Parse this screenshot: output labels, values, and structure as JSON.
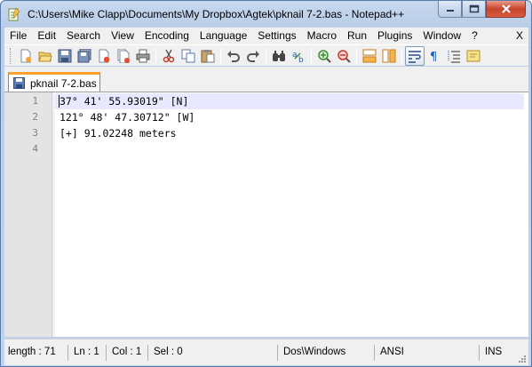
{
  "window": {
    "title": "C:\\Users\\Mike Clapp\\Documents\\My Dropbox\\Agtek\\pknail 7-2.bas - Notepad++"
  },
  "menu": [
    {
      "label": "File",
      "name": "menu-file"
    },
    {
      "label": "Edit",
      "name": "menu-edit"
    },
    {
      "label": "Search",
      "name": "menu-search"
    },
    {
      "label": "View",
      "name": "menu-view"
    },
    {
      "label": "Encoding",
      "name": "menu-encoding"
    },
    {
      "label": "Language",
      "name": "menu-language"
    },
    {
      "label": "Settings",
      "name": "menu-settings"
    },
    {
      "label": "Macro",
      "name": "menu-macro"
    },
    {
      "label": "Run",
      "name": "menu-run"
    },
    {
      "label": "Plugins",
      "name": "menu-plugins"
    },
    {
      "label": "Window",
      "name": "menu-window"
    },
    {
      "label": "?",
      "name": "menu-help"
    }
  ],
  "menu_close_label": "X",
  "toolbar_icons": [
    "new-file-icon",
    "open-file-icon",
    "save-icon",
    "save-all-icon",
    "close-icon",
    "close-all-icon",
    "print-icon",
    "cut-icon",
    "copy-icon",
    "paste-icon",
    "undo-icon",
    "redo-icon",
    "find-icon",
    "replace-icon",
    "zoom-in-icon",
    "zoom-out-icon",
    "sync-vertical-icon",
    "sync-horizontal-icon",
    "word-wrap-icon",
    "show-all-characters-icon",
    "indent-guide-icon",
    "user-language-icon"
  ],
  "tab": {
    "label": "pknail 7-2.bas"
  },
  "editor": {
    "lines": [
      {
        "number": "1",
        "text": "37° 41' 55.93019\" [N]"
      },
      {
        "number": "2",
        "text": "121° 48' 47.30712\" [W]"
      },
      {
        "number": "3",
        "text": "[+] 91.02248 meters"
      },
      {
        "number": "4",
        "text": ""
      }
    ]
  },
  "status": {
    "length": "length : 71",
    "ln": "Ln : 1",
    "col": "Col : 1",
    "sel": "Sel : 0",
    "eol": "Dos\\Windows",
    "encoding": "ANSI",
    "mode": "INS"
  },
  "colors": {
    "tab_accent": "#f8a12b",
    "current_line": "#e8e8ff",
    "gutter": "#e4e4e4"
  }
}
